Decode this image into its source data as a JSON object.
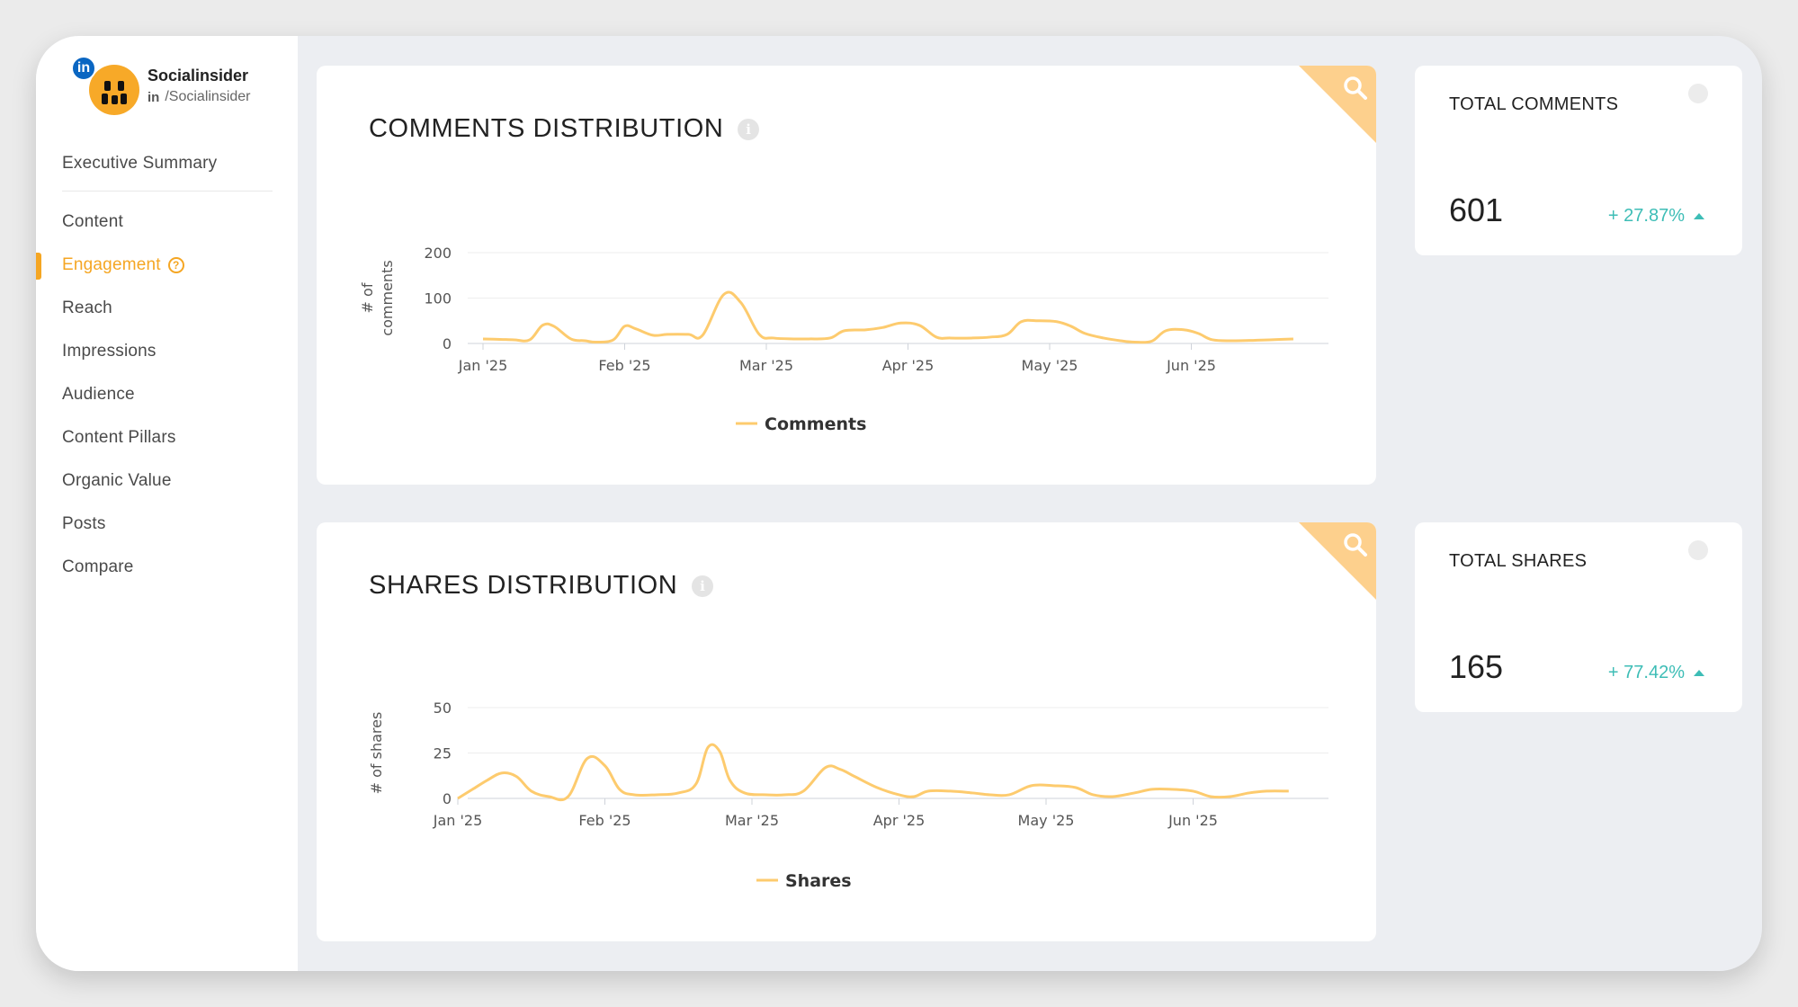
{
  "profile": {
    "name": "Socialinsider",
    "handle": "/Socialinsider",
    "network_badge": "in",
    "network_mini": "in"
  },
  "nav": {
    "summary": "Executive Summary",
    "items": [
      {
        "label": "Content"
      },
      {
        "label": "Engagement",
        "active": true,
        "help": "?"
      },
      {
        "label": "Reach"
      },
      {
        "label": "Impressions"
      },
      {
        "label": "Audience"
      },
      {
        "label": "Content Pillars"
      },
      {
        "label": "Organic Value"
      },
      {
        "label": "Posts"
      },
      {
        "label": "Compare"
      }
    ]
  },
  "colors": {
    "accent": "#f5a623",
    "line": "#fdcb6e",
    "positive": "#3dbdb6",
    "corner": "#fdd08d"
  },
  "comments_card": {
    "title": "COMMENTS DISTRIBUTION",
    "info_icon": "i",
    "zoom_icon": "search-icon"
  },
  "shares_card": {
    "title": "SHARES DISTRIBUTION",
    "info_icon": "i",
    "zoom_icon": "search-icon"
  },
  "stats": {
    "comments": {
      "title": "TOTAL COMMENTS",
      "value": "601",
      "change": "+ 27.87%"
    },
    "shares": {
      "title": "TOTAL SHARES",
      "value": "165",
      "change": "+ 77.42%"
    }
  },
  "chart_data": [
    {
      "type": "line",
      "ylabel": "# of comments",
      "ylim": [
        0,
        200
      ],
      "yticks": [
        "0",
        "100",
        "200"
      ],
      "xticks": [
        "Jan '25",
        "Feb '25",
        "Mar '25",
        "Apr '25",
        "May '25",
        "Jun '25"
      ],
      "grid": true,
      "legend": "bottom",
      "series": [
        {
          "name": "Comments",
          "x": [
            0,
            0.12,
            0.22,
            0.33,
            0.42,
            0.5,
            0.62,
            0.72,
            0.8,
            0.92,
            1.0,
            1.08,
            1.2,
            1.3,
            1.45,
            1.55,
            1.7,
            1.82,
            1.95,
            2.05,
            2.2,
            2.3,
            2.45,
            2.55,
            2.7,
            2.82,
            2.95,
            3.08,
            3.2,
            3.3,
            3.45,
            3.58,
            3.7,
            3.8,
            3.92,
            4.05,
            4.15,
            4.25,
            4.38,
            4.5,
            4.6,
            4.72,
            4.82,
            4.95,
            5.05,
            5.15,
            5.3,
            5.45,
            5.55,
            5.72
          ],
          "values": [
            10,
            9,
            8,
            8,
            40,
            38,
            10,
            6,
            3,
            8,
            38,
            32,
            18,
            20,
            20,
            18,
            108,
            90,
            20,
            12,
            10,
            10,
            12,
            28,
            30,
            35,
            45,
            40,
            14,
            12,
            12,
            14,
            20,
            48,
            50,
            48,
            38,
            22,
            12,
            6,
            3,
            5,
            28,
            30,
            22,
            8,
            6,
            7,
            8,
            10
          ]
        }
      ]
    },
    {
      "type": "line",
      "ylabel": "# of shares",
      "ylim": [
        0,
        50
      ],
      "yticks": [
        "0",
        "25",
        "50"
      ],
      "xticks": [
        "Jan '25",
        "Feb '25",
        "Mar '25",
        "Apr '25",
        "May '25",
        "Jun '25"
      ],
      "grid": true,
      "legend": "bottom",
      "series": [
        {
          "name": "Shares",
          "x": [
            0,
            0.1,
            0.2,
            0.3,
            0.4,
            0.5,
            0.62,
            0.75,
            0.88,
            1.0,
            1.1,
            1.2,
            1.35,
            1.5,
            1.62,
            1.7,
            1.78,
            1.85,
            1.95,
            2.1,
            2.22,
            2.35,
            2.5,
            2.6,
            2.7,
            2.85,
            3.0,
            3.1,
            3.2,
            3.35,
            3.5,
            3.62,
            3.75,
            3.9,
            4.05,
            4.2,
            4.32,
            4.45,
            4.6,
            4.72,
            4.85,
            5.0,
            5.12,
            5.25,
            5.38,
            5.5,
            5.65
          ],
          "values": [
            0,
            5,
            10,
            14,
            12,
            4,
            1,
            1,
            22,
            18,
            5,
            2,
            2,
            3,
            8,
            28,
            26,
            10,
            3,
            2,
            2,
            4,
            17,
            16,
            12,
            6,
            2,
            1,
            4,
            4,
            3,
            2,
            2,
            7,
            7,
            6,
            2,
            1,
            3,
            5,
            5,
            4,
            1,
            1,
            3,
            4,
            4
          ]
        }
      ]
    }
  ]
}
